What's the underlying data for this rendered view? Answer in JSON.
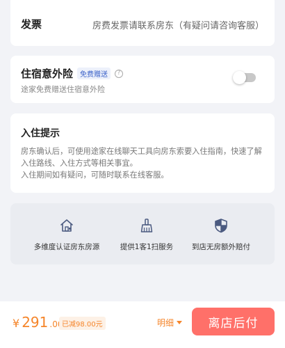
{
  "invoice": {
    "title": "发票",
    "description": "房费发票请联系房东（有疑问请咨询客服）"
  },
  "insurance": {
    "title": "住宿意外险",
    "badge": "免费赠送",
    "help_icon": "question-circle-icon",
    "subtitle": "途家免费赠送住宿意外险",
    "toggle_on": false
  },
  "checkin_tips": {
    "title": "入住提示",
    "line1": "房东确认后，可使用途家在线聊天工具向房东索要入住指南，快速了解入住路线、入住方式等相关事宜。",
    "line2": "入住期间如有疑问，可随时联系在线客服。"
  },
  "features": [
    {
      "icon": "house-icon",
      "label": "多维度认证房东房源"
    },
    {
      "icon": "broom-icon",
      "label": "提供1客1扫服务"
    },
    {
      "icon": "shield-icon",
      "label": "到店无房额外赔付"
    }
  ],
  "bottom_bar": {
    "currency": "¥",
    "amount": "291",
    "decimal": ".00",
    "discount": "已减98.00元",
    "detail_label": "明细",
    "pay_button": "离店后付"
  },
  "colors": {
    "accent": "#f5852a",
    "pay_button": "#ff7069",
    "badge": "#3d63c9"
  }
}
